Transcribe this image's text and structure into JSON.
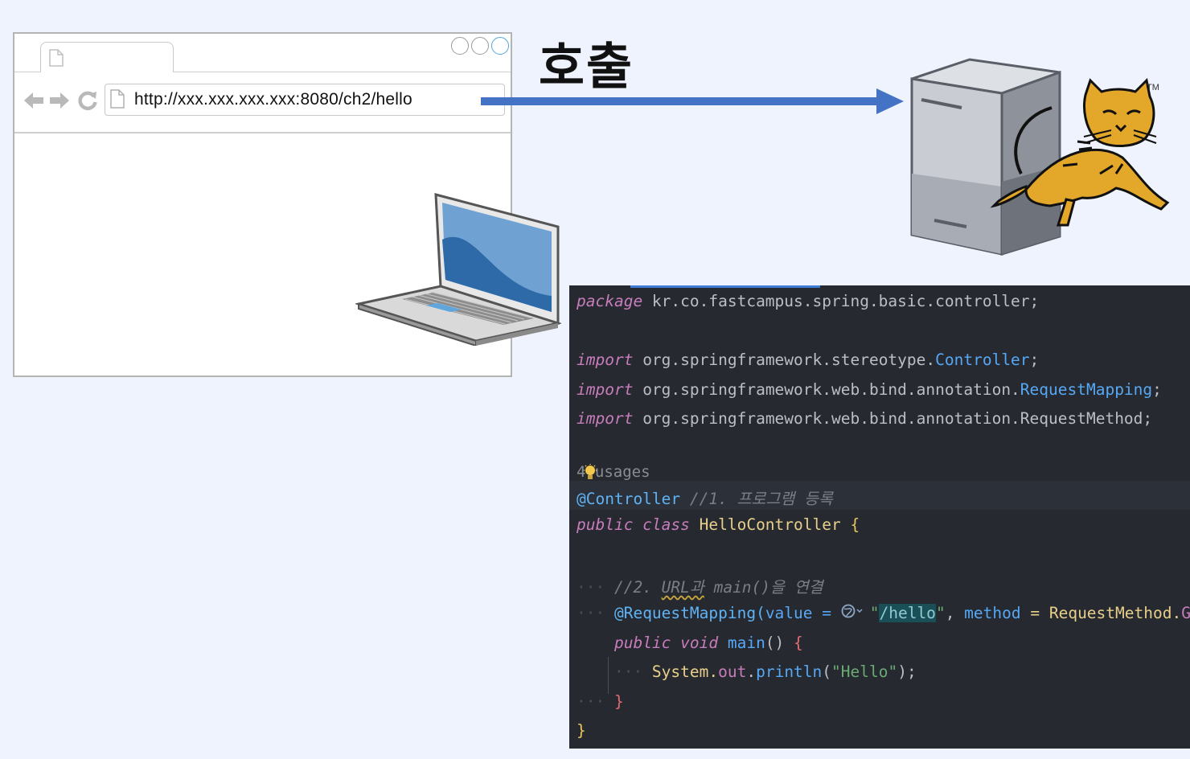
{
  "browser": {
    "url": "http://xxx.xxx.xxx.xxx:8080/ch2/hello"
  },
  "arrow_label": "호출",
  "server": {
    "trademark": "TM"
  },
  "code": {
    "lines": {
      "l1_kw": "package",
      "l1_rest": " kr.co.fastcampus.spring.basic.controller;",
      "l3_kw": "import",
      "l3_pkg": " org.springframework.stereotype.",
      "l3_cls": "Controller",
      "l3_end": ";",
      "l4_kw": "import",
      "l4_pkg": " org.springframework.web.bind.annotation.",
      "l4_cls": "RequestMapping",
      "l4_end": ";",
      "l5_kw": "import",
      "l5_pkg": " org.springframework.web.bind.annotation.RequestMethod;",
      "usages": "4 usages",
      "l7_ann": "@Controller",
      "l7_cmt": " //1. 프로그램 등록",
      "l8_kw": "public class",
      "l8_name": " HelloController ",
      "l8_brace": "{",
      "l10_cmt_a": "//2. ",
      "l10_cmt_b": "URL과",
      "l10_cmt_c": " main()을 연결",
      "l11_ann": "@RequestMapping(",
      "l11_attr": "value = ",
      "l11_q1": "\"",
      "l11_str": "/hello",
      "l11_q2": "\"",
      "l11_mid": ", ",
      "l11_attr2": "method",
      "l11_eq": " = RequestMethod.",
      "l11_get": "GET",
      "l11_end": ")",
      "l12_kw": "public void",
      "l12_name": " main",
      "l12_paren": "() ",
      "l12_brace": "{",
      "l13_a": "System.",
      "l13_out": "out",
      "l13_b": ".",
      "l13_fn": "println",
      "l13_c": "(",
      "l13_str": "\"Hello\"",
      "l13_d": ");",
      "l14_brace": "}",
      "l15_brace": "}"
    }
  },
  "colors": {
    "background": "#eef3fd",
    "arrow": "#4472c4",
    "code_bg": "#262930"
  }
}
